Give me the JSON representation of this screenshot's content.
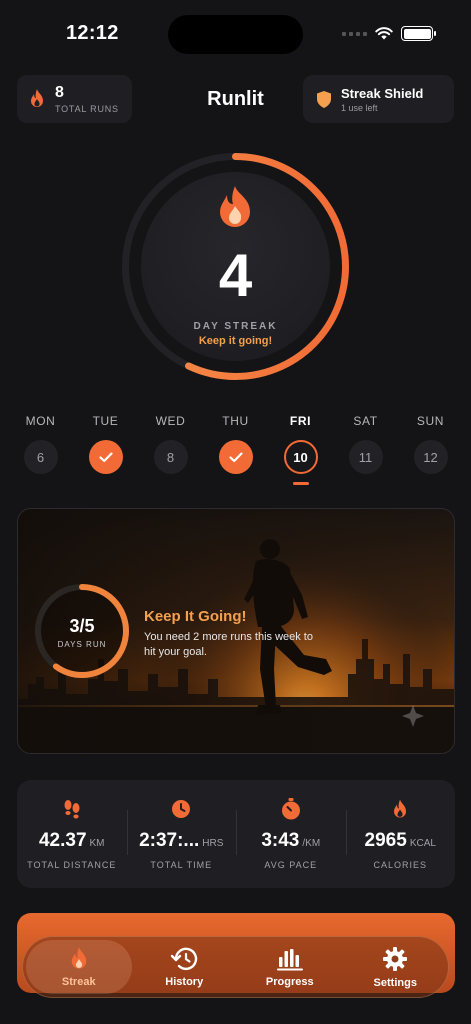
{
  "status": {
    "time": "12:12"
  },
  "header": {
    "runs_count": "8",
    "runs_label": "TOTAL RUNS",
    "title": "Runlit",
    "shield_title": "Streak Shield",
    "shield_sub": "1 use left"
  },
  "streak": {
    "count": "4",
    "label": "DAY STREAK",
    "subtitle": "Keep it going!",
    "progress": 0.57
  },
  "week": [
    {
      "name": "MON",
      "date": "6",
      "state": "none"
    },
    {
      "name": "TUE",
      "date": "✓",
      "state": "done"
    },
    {
      "name": "WED",
      "date": "8",
      "state": "none"
    },
    {
      "name": "THU",
      "date": "✓",
      "state": "done"
    },
    {
      "name": "FRI",
      "date": "10",
      "state": "today"
    },
    {
      "name": "SAT",
      "date": "11",
      "state": "none"
    },
    {
      "name": "SUN",
      "date": "12",
      "state": "none"
    }
  ],
  "goal": {
    "value": "3/5",
    "label": "DAYS RUN",
    "progress": 0.6,
    "title": "Keep It Going!",
    "text": "You need 2 more runs this week to hit your goal."
  },
  "stats": [
    {
      "icon": "footprints-icon",
      "value": "42.37",
      "unit": "KM",
      "label": "TOTAL DISTANCE"
    },
    {
      "icon": "clock-icon",
      "value": "2:37:...",
      "unit": "HRS",
      "label": "TOTAL TIME"
    },
    {
      "icon": "stopwatch-icon",
      "value": "3:43",
      "unit": "/KM",
      "label": "AVG PACE"
    },
    {
      "icon": "flame-icon",
      "value": "2965",
      "unit": "KCAL",
      "label": "CALORIES"
    }
  ],
  "nav": {
    "streak": "Streak",
    "history": "History",
    "progress": "Progress",
    "settings": "Settings"
  },
  "colors": {
    "accent": "#f26a35",
    "accent_light": "#f5a04e",
    "background": "#141416",
    "card": "#1f1f23"
  }
}
